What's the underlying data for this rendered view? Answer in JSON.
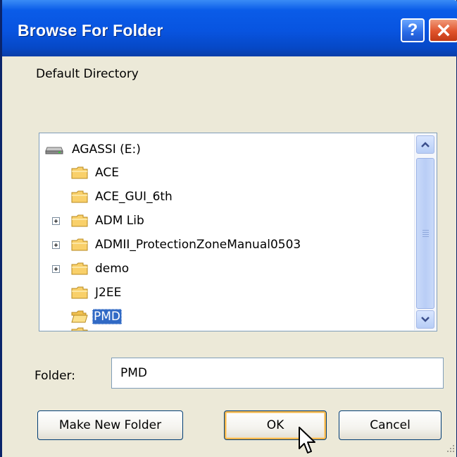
{
  "window": {
    "title": "Browse For Folder",
    "help_icon": "question-mark",
    "close_icon": "x-mark",
    "colors": {
      "title_bar": "#0854e0",
      "dialog_bg": "#ece9d8",
      "selection": "#316ac5"
    }
  },
  "dialog": {
    "description": "Default Directory"
  },
  "tree": {
    "root": {
      "label": "AGASSI (E:)",
      "icon": "drive-icon"
    },
    "items": [
      {
        "label": "ACE",
        "expandable": false,
        "selected": false
      },
      {
        "label": "ACE_GUI_6th",
        "expandable": false,
        "selected": false
      },
      {
        "label": "ADM Lib",
        "expandable": true,
        "selected": false
      },
      {
        "label": "ADMII_ProtectionZoneManual0503",
        "expandable": true,
        "selected": false
      },
      {
        "label": "demo",
        "expandable": true,
        "selected": false
      },
      {
        "label": "J2EE",
        "expandable": false,
        "selected": false
      },
      {
        "label": "PMD",
        "expandable": false,
        "selected": true
      }
    ]
  },
  "folder_field": {
    "label": "Folder:",
    "value": "PMD"
  },
  "buttons": {
    "make_new_folder": "Make New Folder",
    "ok": "OK",
    "cancel": "Cancel"
  }
}
